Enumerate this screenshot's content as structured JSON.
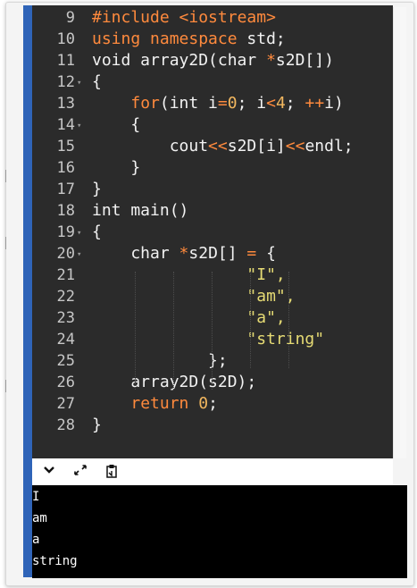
{
  "editor": {
    "lines": [
      {
        "no": "9",
        "fold": false,
        "parts": [
          {
            "t": "#include ",
            "c": "kw"
          },
          {
            "t": "<iostream>",
            "c": "kw"
          }
        ]
      },
      {
        "no": "10",
        "fold": false,
        "parts": [
          {
            "t": "using namespace ",
            "c": "kw"
          },
          {
            "t": "std;",
            "c": "tp"
          }
        ]
      },
      {
        "no": "11",
        "fold": false,
        "parts": [
          {
            "t": "void array2D(char ",
            "c": "tp"
          },
          {
            "t": "*",
            "c": "op"
          },
          {
            "t": "s2D[])",
            "c": "tp"
          }
        ]
      },
      {
        "no": "12",
        "fold": true,
        "parts": [
          {
            "t": "{",
            "c": "tp"
          }
        ]
      },
      {
        "no": "13",
        "fold": false,
        "parts": [
          {
            "t": "    ",
            "c": "tp"
          },
          {
            "t": "for",
            "c": "kw"
          },
          {
            "t": "(int i",
            "c": "tp"
          },
          {
            "t": "=",
            "c": "op"
          },
          {
            "t": "0",
            "c": "num"
          },
          {
            "t": "; i",
            "c": "tp"
          },
          {
            "t": "<",
            "c": "op"
          },
          {
            "t": "4",
            "c": "num"
          },
          {
            "t": "; ",
            "c": "tp"
          },
          {
            "t": "++",
            "c": "op"
          },
          {
            "t": "i)",
            "c": "tp"
          }
        ]
      },
      {
        "no": "14",
        "fold": true,
        "parts": [
          {
            "t": "    {",
            "c": "tp"
          }
        ]
      },
      {
        "no": "15",
        "fold": false,
        "parts": [
          {
            "t": "        cout",
            "c": "tp"
          },
          {
            "t": "<<",
            "c": "op"
          },
          {
            "t": "s2D[i]",
            "c": "tp"
          },
          {
            "t": "<<",
            "c": "op"
          },
          {
            "t": "endl;",
            "c": "tp"
          }
        ]
      },
      {
        "no": "16",
        "fold": false,
        "parts": [
          {
            "t": "    }",
            "c": "tp"
          }
        ]
      },
      {
        "no": "17",
        "fold": false,
        "parts": [
          {
            "t": "}",
            "c": "tp"
          }
        ]
      },
      {
        "no": "18",
        "fold": false,
        "parts": [
          {
            "t": "int main()",
            "c": "tp"
          }
        ]
      },
      {
        "no": "19",
        "fold": true,
        "parts": [
          {
            "t": "{",
            "c": "tp"
          }
        ]
      },
      {
        "no": "20",
        "fold": true,
        "parts": [
          {
            "t": "    char ",
            "c": "tp"
          },
          {
            "t": "*",
            "c": "op"
          },
          {
            "t": "s2D[] ",
            "c": "tp"
          },
          {
            "t": "=",
            "c": "op"
          },
          {
            "t": " {",
            "c": "tp"
          }
        ]
      },
      {
        "no": "21",
        "fold": false,
        "parts": [
          {
            "t": "                \"I\",",
            "c": "str"
          }
        ]
      },
      {
        "no": "22",
        "fold": false,
        "parts": [
          {
            "t": "                \"am\",",
            "c": "str"
          }
        ]
      },
      {
        "no": "23",
        "fold": false,
        "parts": [
          {
            "t": "                \"a\",",
            "c": "str"
          }
        ]
      },
      {
        "no": "24",
        "fold": false,
        "parts": [
          {
            "t": "                \"string\"",
            "c": "str"
          }
        ]
      },
      {
        "no": "25",
        "fold": false,
        "parts": [
          {
            "t": "            };",
            "c": "tp"
          }
        ]
      },
      {
        "no": "26",
        "fold": false,
        "parts": [
          {
            "t": "    array2D(s2D);",
            "c": "tp"
          }
        ]
      },
      {
        "no": "27",
        "fold": false,
        "parts": [
          {
            "t": "    ",
            "c": "tp"
          },
          {
            "t": "return ",
            "c": "kw"
          },
          {
            "t": "0",
            "c": "num"
          },
          {
            "t": ";",
            "c": "tp"
          }
        ]
      },
      {
        "no": "28",
        "fold": false,
        "parts": [
          {
            "t": "}",
            "c": "tp"
          }
        ]
      }
    ]
  },
  "toolbar": {
    "collapse_icon": "chevron-down-icon",
    "expand_icon": "expand-arrows-icon",
    "clipboard_icon": "clipboard-icon"
  },
  "console": {
    "output": [
      "I",
      "am",
      "a",
      "string"
    ]
  },
  "colors": {
    "editor_bg": "#2b2b2b",
    "keyword": "#ff8a3d",
    "string": "#e6db74",
    "number": "#f2b75f",
    "text": "#f2f2f2",
    "accent_edge": "#2f64b8",
    "console_bg": "#000000"
  }
}
